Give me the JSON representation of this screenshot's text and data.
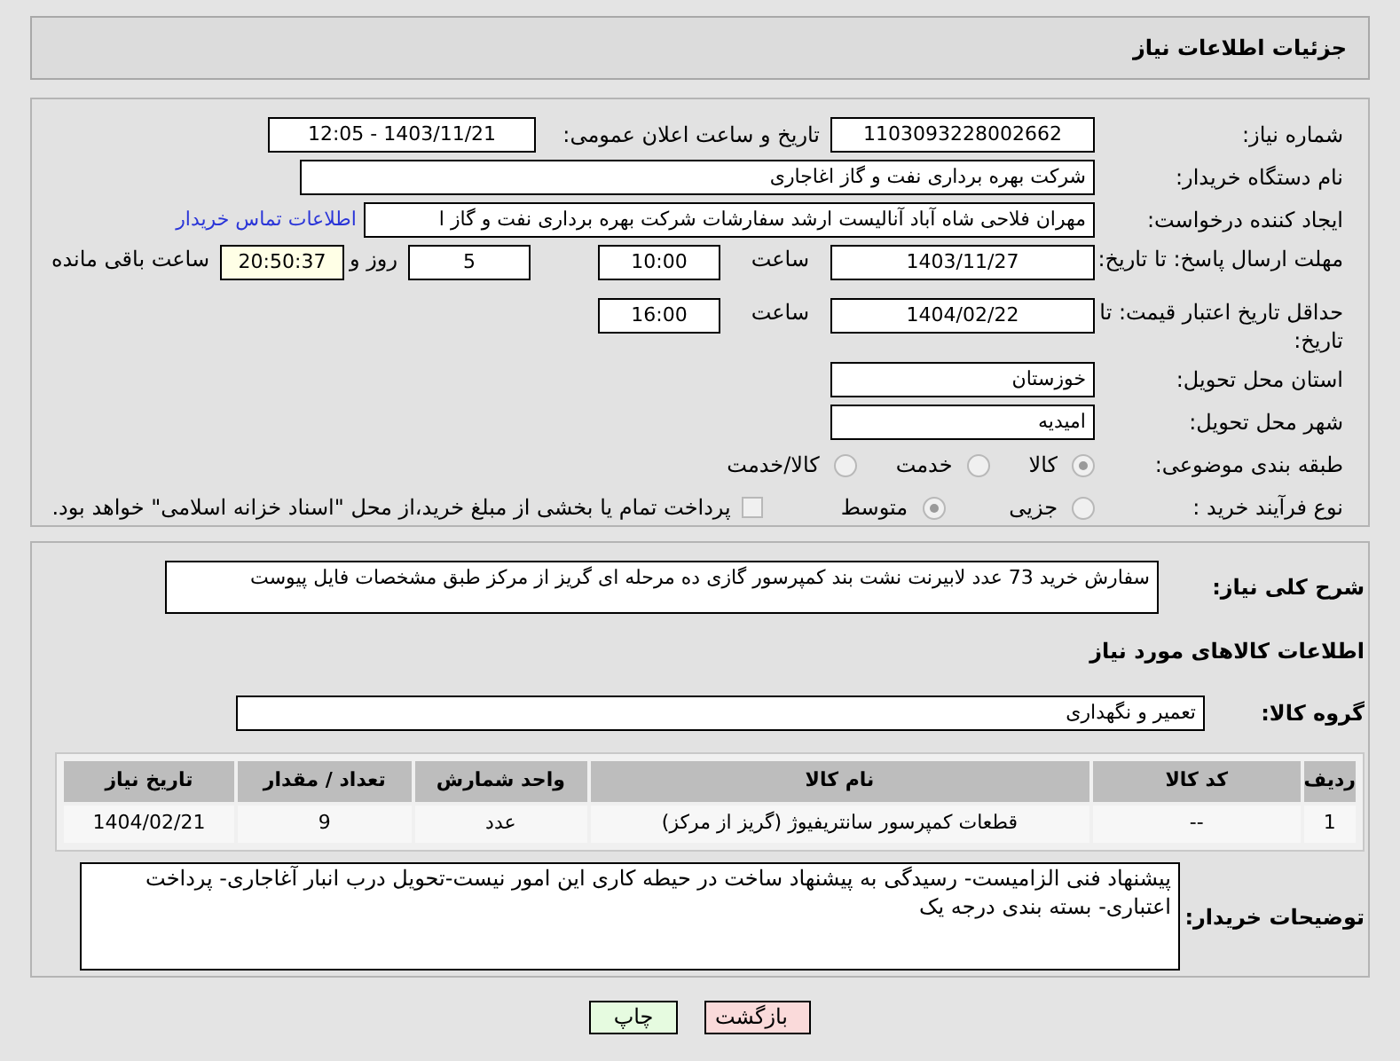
{
  "header": {
    "title": "جزئیات اطلاعات نیاز"
  },
  "info": {
    "need_number": {
      "label": "شماره نیاز:",
      "value": "1103093228002662"
    },
    "announce": {
      "label": "تاریخ و ساعت اعلان عمومی:",
      "value": "1403/11/21 - 12:05"
    },
    "buyer": {
      "label": "نام دستگاه خریدار:",
      "value": "شرکت بهره برداری نفت و گاز اغاجاری"
    },
    "creator": {
      "label": "ایجاد کننده درخواست:",
      "value": "مهران فلاحی شاه آباد آنالیست ارشد سفارشات شرکت بهره برداری نفت و گاز ا",
      "link": "اطلاعات تماس خریدار"
    },
    "deadline": {
      "label": "مهلت ارسال پاسخ: تا تاریخ:",
      "date": "1403/11/27",
      "time_label": "ساعت",
      "time": "10:00",
      "days": "5",
      "days_label": "روز و",
      "remaining": "20:50:37",
      "remaining_label": "ساعت باقی مانده"
    },
    "validity": {
      "label": "حداقل تاریخ اعتبار قیمت: تا تاریخ:",
      "date": "1404/02/22",
      "time_label": "ساعت",
      "time": "16:00"
    },
    "province": {
      "label": "استان محل تحویل:",
      "value": "خوزستان"
    },
    "city": {
      "label": "شهر محل تحویل:",
      "value": "امیدیه"
    },
    "category": {
      "label": "طبقه بندی موضوعی:",
      "options": [
        {
          "label": "کالا",
          "selected": true
        },
        {
          "label": "خدمت",
          "selected": false
        },
        {
          "label": "کالا/خدمت",
          "selected": false
        }
      ]
    },
    "process": {
      "label": "نوع فرآیند خرید :",
      "options": [
        {
          "label": "جزیی",
          "selected": false
        },
        {
          "label": "متوسط",
          "selected": true
        }
      ],
      "treasury": {
        "label": "پرداخت تمام یا بخشی از مبلغ خرید،از محل \"اسناد خزانه اسلامی\" خواهد بود.",
        "checked": false
      }
    }
  },
  "need": {
    "description": {
      "label": "شرح کلی نیاز:",
      "value": "سفارش خرید 73 عدد لابیرنت نشت بند کمپرسور گازی ده مرحله ای گریز از مرکز طبق مشخصات فایل پیوست"
    },
    "goods_heading": "اطلاعات کالاهای مورد نیاز",
    "group": {
      "label": "گروه کالا:",
      "value": "تعمیر و نگهداری"
    },
    "table": {
      "columns": [
        "ردیف",
        "کد کالا",
        "نام کالا",
        "واحد شمارش",
        "تعداد / مقدار",
        "تاریخ نیاز"
      ],
      "rows": [
        [
          "1",
          "--",
          "قطعات کمپرسور سانتریفیوژ (گریز از مرکز)",
          "عدد",
          "9",
          "1404/02/21"
        ]
      ]
    },
    "buyer_notes": {
      "label": "توضیحات خریدار:",
      "value": "پیشنهاد فنی الزامیست- رسیدگی به پیشنهاد ساخت در حیطه کاری این امور نیست-تحویل درب انبار آغاجاری- پرداخت اعتباری- بسته بندی درجه یک"
    }
  },
  "buttons": [
    {
      "label": "بازگشت",
      "kind": "back"
    },
    {
      "label": "چاپ",
      "kind": "print"
    }
  ]
}
